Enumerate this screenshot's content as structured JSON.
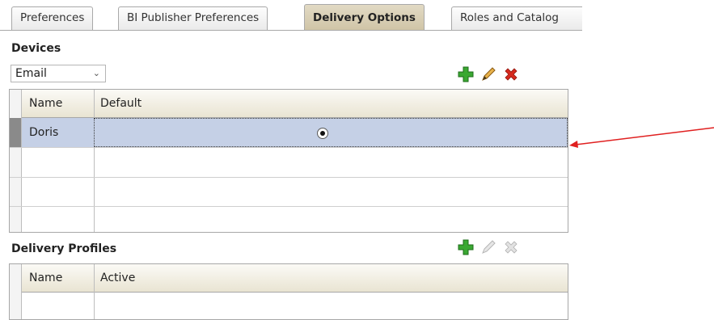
{
  "tabs": [
    {
      "label": "Preferences",
      "active": false
    },
    {
      "label": "BI Publisher Preferences",
      "active": false
    },
    {
      "label": "Delivery Options",
      "active": true
    },
    {
      "label": "Roles and Catalog",
      "active": false
    }
  ],
  "devices": {
    "title": "Devices",
    "selected_device_type": "Email",
    "columns": [
      "Name",
      "Default"
    ],
    "rows": [
      {
        "name": "Doris",
        "default": true,
        "selected": true
      }
    ],
    "toolbar": {
      "add_icon": "plus-icon",
      "edit_icon": "pencil-icon",
      "delete_icon": "x-icon"
    }
  },
  "delivery_profiles": {
    "title": "Delivery Profiles",
    "columns": [
      "Name",
      "Active"
    ],
    "toolbar": {
      "add_icon": "plus-icon",
      "edit_icon": "pencil-icon",
      "delete_icon": "x-icon",
      "edit_disabled": true,
      "delete_disabled": true
    }
  },
  "colors": {
    "selected_row": "#c5d0e6",
    "active_tab": "#d8cfb5",
    "annotation_arrow": "#e02020"
  }
}
